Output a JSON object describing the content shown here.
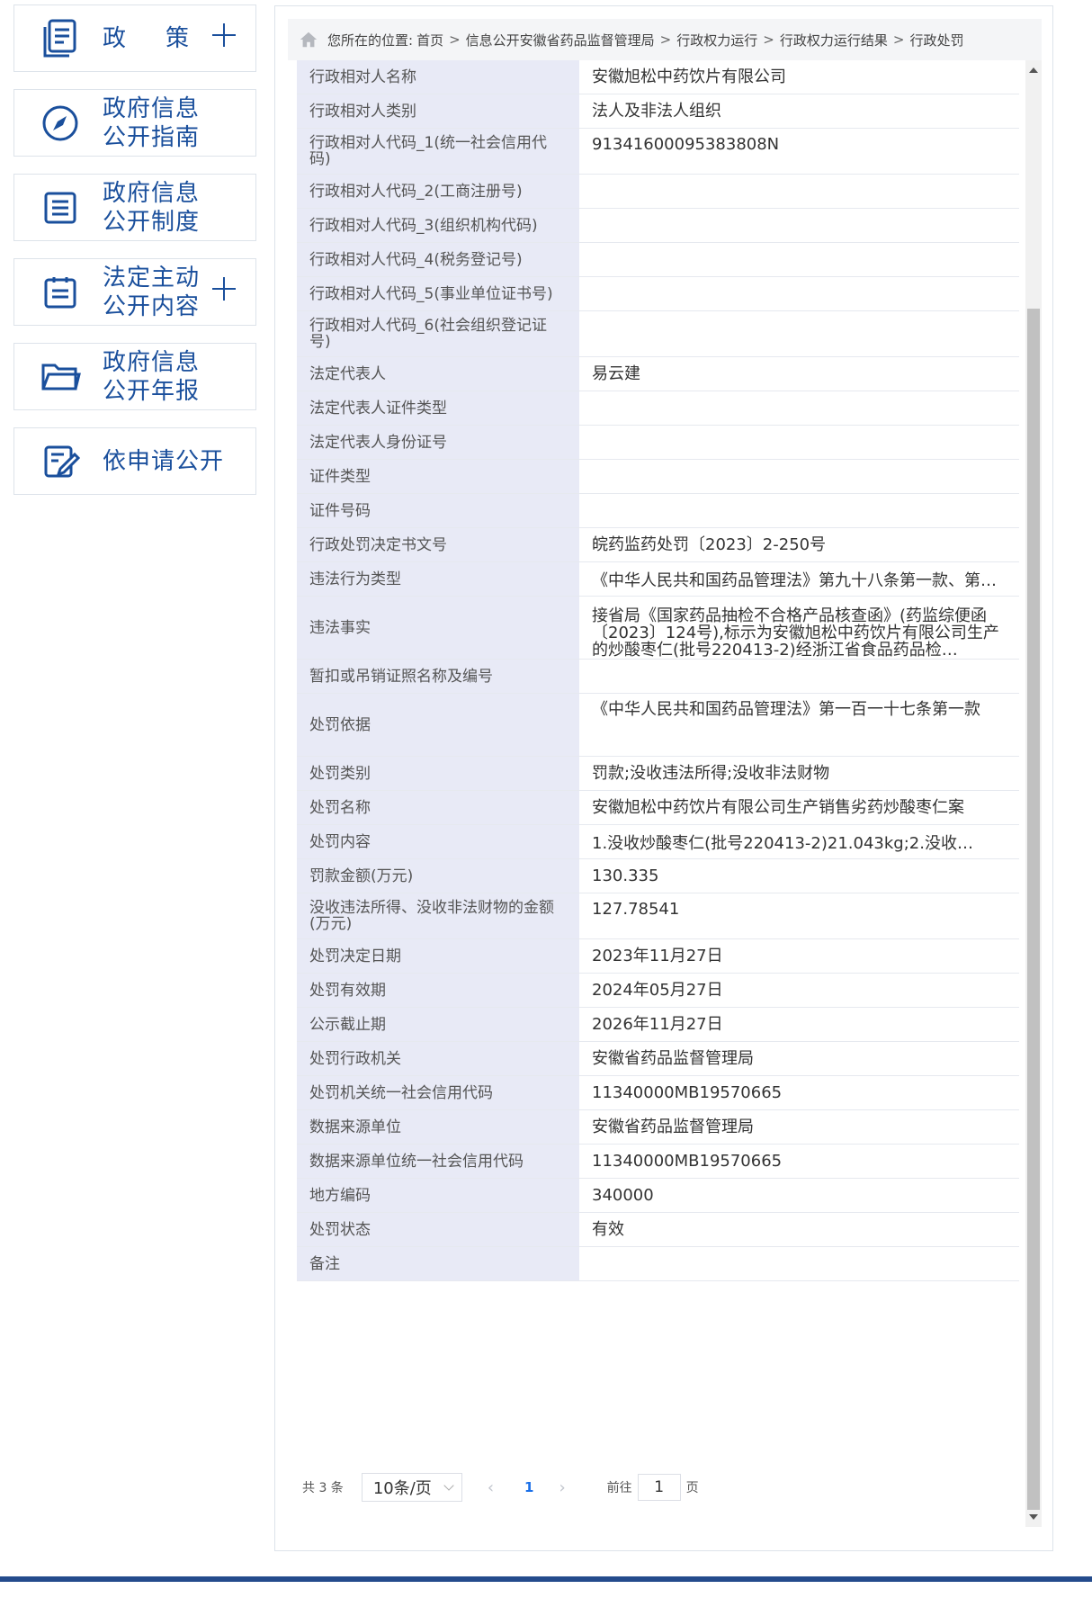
{
  "sidebar": {
    "items": [
      {
        "label": "政策",
        "icon": "document-icon",
        "expandable": true
      },
      {
        "label": "政府信息\n公开指南",
        "icon": "compass-icon",
        "expandable": false
      },
      {
        "label": "政府信息\n公开制度",
        "icon": "list-icon",
        "expandable": false
      },
      {
        "label": "法定主动\n公开内容",
        "icon": "clipboard-icon",
        "expandable": true
      },
      {
        "label": "政府信息\n公开年报",
        "icon": "folder-icon",
        "expandable": false
      },
      {
        "label": "依申请公开",
        "icon": "edit-icon",
        "expandable": false
      }
    ]
  },
  "breadcrumb": {
    "prefix": "您所在的位置:",
    "items": [
      "首页",
      "信息公开安徽省药品监督管理局",
      "行政权力运行",
      "行政权力运行结果",
      "行政处罚"
    ]
  },
  "table": {
    "rows": [
      {
        "k": "行政相对人名称",
        "v": "安徽旭松中药饮片有限公司"
      },
      {
        "k": "行政相对人类别",
        "v": "法人及非法人组织"
      },
      {
        "k": "行政相对人代码_1(统一社会信用代码)",
        "v": "91341600095383808N"
      },
      {
        "k": "行政相对人代码_2(工商注册号)",
        "v": ""
      },
      {
        "k": "行政相对人代码_3(组织机构代码)",
        "v": ""
      },
      {
        "k": "行政相对人代码_4(税务登记号)",
        "v": ""
      },
      {
        "k": "行政相对人代码_5(事业单位证书号)",
        "v": ""
      },
      {
        "k": "行政相对人代码_6(社会组织登记证号)",
        "v": ""
      },
      {
        "k": "法定代表人",
        "v": "易云建"
      },
      {
        "k": "法定代表人证件类型",
        "v": ""
      },
      {
        "k": "法定代表人身份证号",
        "v": ""
      },
      {
        "k": "证件类型",
        "v": ""
      },
      {
        "k": "证件号码",
        "v": ""
      },
      {
        "k": "行政处罚决定书文号",
        "v": "皖药监药处罚〔2023〕2-250号"
      },
      {
        "k": "违法行为类型",
        "v": "《中华人民共和国药品管理法》第九十八条第一款、第…"
      },
      {
        "k": "违法事实",
        "v": "接省局《国家药品抽检不合格产品核查函》(药监综便函〔2023〕124号),标示为安徽旭松中药饮片有限公司生产的炒酸枣仁(批号220413-2)经浙江省食品药品检…"
      },
      {
        "k": "暂扣或吊销证照名称及编号",
        "v": ""
      },
      {
        "k": "处罚依据",
        "v": "《中华人民共和国药品管理法》第一百一十七条第一款"
      },
      {
        "k": "处罚类别",
        "v": "罚款;没收违法所得;没收非法财物"
      },
      {
        "k": "处罚名称",
        "v": "安徽旭松中药饮片有限公司生产销售劣药炒酸枣仁案"
      },
      {
        "k": "处罚内容",
        "v": "1.没收炒酸枣仁(批号220413-2)21.043kg;2.没收…"
      },
      {
        "k": "罚款金额(万元)",
        "v": "130.335"
      },
      {
        "k": "没收违法所得、没收非法财物的金额(万元)",
        "v": "127.78541"
      },
      {
        "k": "处罚决定日期",
        "v": "2023年11月27日"
      },
      {
        "k": "处罚有效期",
        "v": "2024年05月27日"
      },
      {
        "k": "公示截止期",
        "v": "2026年11月27日"
      },
      {
        "k": "处罚行政机关",
        "v": "安徽省药品监督管理局"
      },
      {
        "k": "处罚机关统一社会信用代码",
        "v": "11340000MB19570665"
      },
      {
        "k": "数据来源单位",
        "v": "安徽省药品监督管理局"
      },
      {
        "k": "数据来源单位统一社会信用代码",
        "v": "11340000MB19570665"
      },
      {
        "k": "地方编码",
        "v": "340000"
      },
      {
        "k": "处罚状态",
        "v": "有效"
      },
      {
        "k": "备注",
        "v": ""
      }
    ]
  },
  "pager": {
    "total": "共 3 条",
    "page_size": "10条/页",
    "current_page": "1",
    "goto_prefix": "前往",
    "goto_value": "1",
    "goto_suffix": "页"
  },
  "colors": {
    "accent": "#1a4f9c",
    "label_bg": "#e8eaf6",
    "pager_active": "#1a6fe8",
    "footer_bar": "#244b8c"
  }
}
